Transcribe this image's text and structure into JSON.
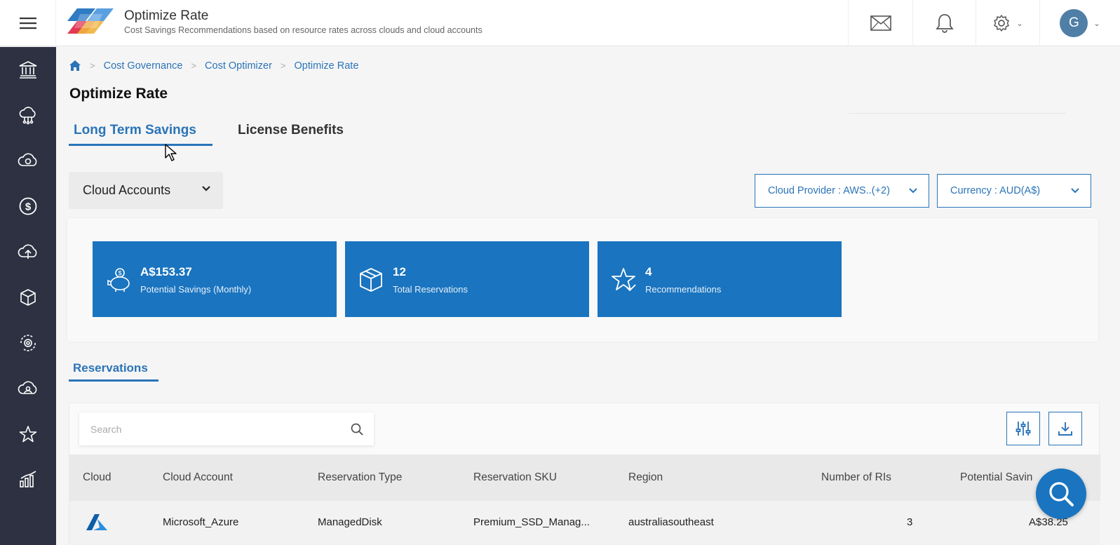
{
  "header": {
    "title": "Optimize Rate",
    "subtitle": "Cost Savings Recommendations based on resource rates across clouds and cloud accounts",
    "avatar_initial": "G"
  },
  "sidebar": {
    "items": [
      {
        "icon": "bank-icon"
      },
      {
        "icon": "cloud-network-icon"
      },
      {
        "icon": "cloud-sync-icon"
      },
      {
        "icon": "dollar-icon"
      },
      {
        "icon": "cloud-upload-icon"
      },
      {
        "icon": "cube-icon"
      },
      {
        "icon": "gear-cycle-icon"
      },
      {
        "icon": "cloud-people-icon"
      },
      {
        "icon": "star-icon"
      },
      {
        "icon": "bar-chart-icon"
      }
    ]
  },
  "breadcrumb": {
    "items": [
      "Cost Governance",
      "Cost Optimizer",
      "Optimize Rate"
    ]
  },
  "page": {
    "title": "Optimize Rate"
  },
  "tabs": {
    "active": "Long Term Savings",
    "inactive": "License Benefits"
  },
  "filters": {
    "accounts": "Cloud Accounts",
    "provider": "Cloud Provider : AWS..(+2)",
    "currency": "Currency : AUD(A$)"
  },
  "cards": [
    {
      "value": "A$153.37",
      "label": "Potential Savings (Monthly)",
      "icon": "piggy-bank-icon"
    },
    {
      "value": "12",
      "label": "Total Reservations",
      "icon": "box-icon"
    },
    {
      "value": "4",
      "label": "Recommendations",
      "icon": "star-check-icon"
    }
  ],
  "reservations": {
    "tab_label": "Reservations",
    "search_placeholder": "Search",
    "columns": [
      "Cloud",
      "Cloud Account",
      "Reservation Type",
      "Reservation SKU",
      "Region",
      "Number of RIs",
      "Potential Savin"
    ],
    "rows": [
      {
        "cloud_icon": "azure-icon",
        "account": "Microsoft_Azure",
        "type": "ManagedDisk",
        "sku": "Premium_SSD_Manag...",
        "region": "australiasoutheast",
        "ris": "3",
        "savings": "A$38.25"
      }
    ]
  },
  "colors": {
    "accent": "#1a74bf",
    "sidebar": "#2d3141"
  }
}
